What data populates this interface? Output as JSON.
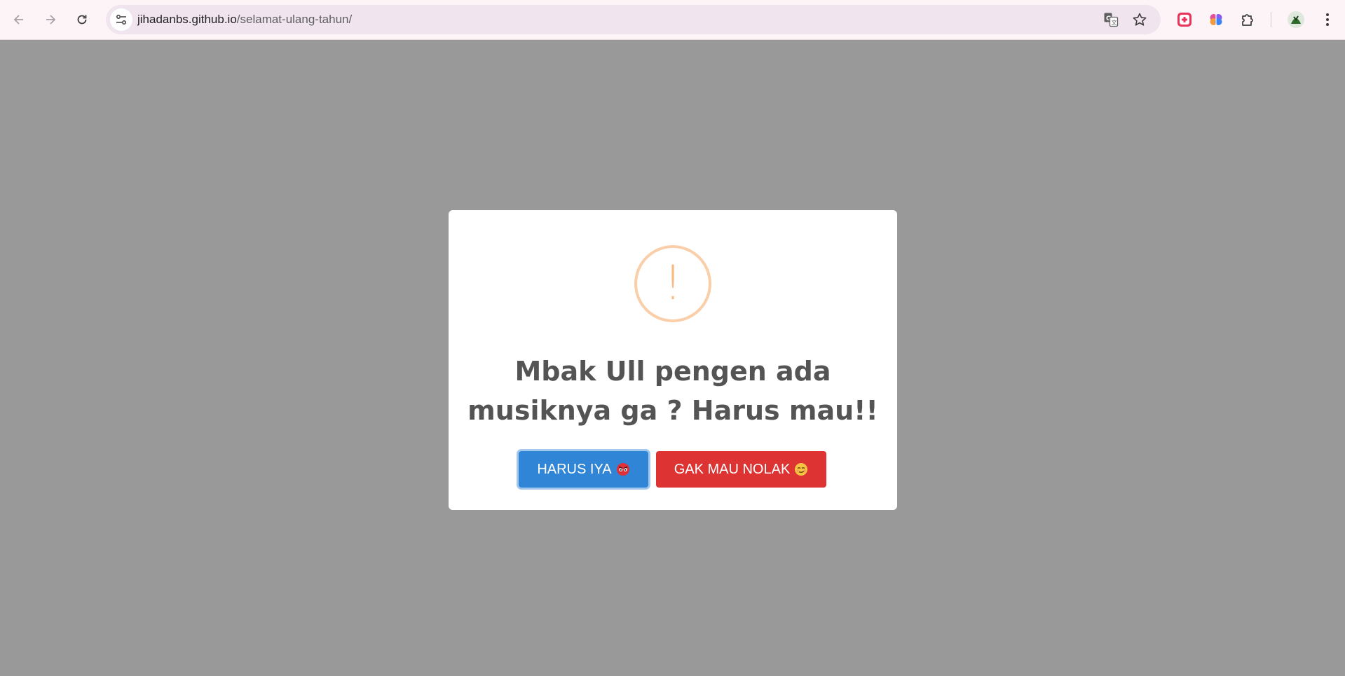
{
  "browser": {
    "url_host": "jihadanbs.github.io",
    "url_path": "/selamat-ulang-tahun/",
    "icons": {
      "back": "back-arrow-icon",
      "forward": "forward-arrow-icon",
      "reload": "reload-icon",
      "site_info": "tune-icon",
      "translate": "translate-icon",
      "bookmark": "star-icon",
      "extension_1": "red-plus-extension-icon",
      "extension_2": "brain-extension-icon",
      "extensions": "puzzle-icon",
      "profile": "avatar-icon",
      "menu": "kebab-menu-icon"
    }
  },
  "dialog": {
    "icon": "warning-exclamation-icon",
    "icon_glyph": "!",
    "title": "Mbak Ull pengen ada musiknya ga ? Harus mau!!",
    "confirm_label": "HARUS IYA",
    "cancel_label": "GAK MAU NOLAK",
    "confirm_emoji": "angry-face-icon",
    "cancel_emoji": "smirk-face-icon",
    "colors": {
      "overlay": "#999999",
      "confirm": "#3085d6",
      "cancel": "#dd3333",
      "warning": "#f8bb86",
      "title": "#545454"
    }
  }
}
